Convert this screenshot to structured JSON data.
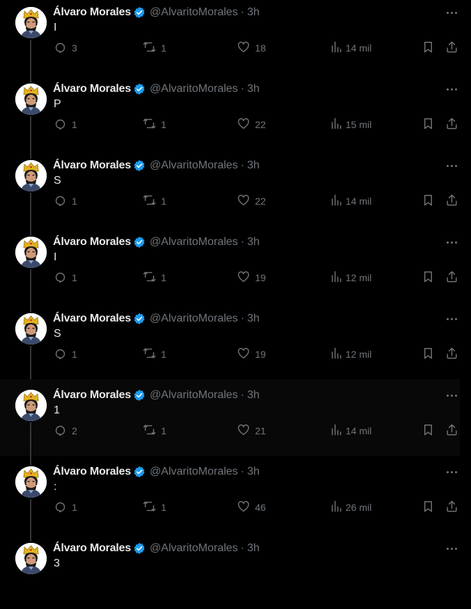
{
  "author": {
    "name": "Álvaro Morales",
    "handle": "@AlvaritoMorales",
    "separator": "·",
    "time": "3h"
  },
  "colors": {
    "background": "#000000",
    "text": "#e7e9ea",
    "muted": "#71767b",
    "verified": "#1d9bf0",
    "highlight_row": "#080808"
  },
  "icons": {
    "reply": "speech-bubble-icon",
    "retweet": "retweet-icon",
    "like": "heart-icon",
    "views": "bar-chart-icon",
    "bookmark": "bookmark-icon",
    "share": "share-icon",
    "more": "more-dots-icon",
    "verified": "verified-badge-icon"
  },
  "tweets": [
    {
      "text": "I",
      "replies": "3",
      "retweets": "1",
      "likes": "18",
      "views": "14 mil"
    },
    {
      "text": "P",
      "replies": "1",
      "retweets": "1",
      "likes": "22",
      "views": "15 mil"
    },
    {
      "text": "S",
      "replies": "1",
      "retweets": "1",
      "likes": "22",
      "views": "14 mil"
    },
    {
      "text": "I",
      "replies": "1",
      "retweets": "1",
      "likes": "19",
      "views": "12 mil"
    },
    {
      "text": "S",
      "replies": "1",
      "retweets": "1",
      "likes": "19",
      "views": "12 mil"
    },
    {
      "text": "1",
      "replies": "2",
      "retweets": "1",
      "likes": "21",
      "views": "14 mil",
      "highlighted": true
    },
    {
      "text": ":",
      "replies": "1",
      "retweets": "1",
      "likes": "46",
      "views": "26 mil"
    },
    {
      "text": "3"
    }
  ]
}
